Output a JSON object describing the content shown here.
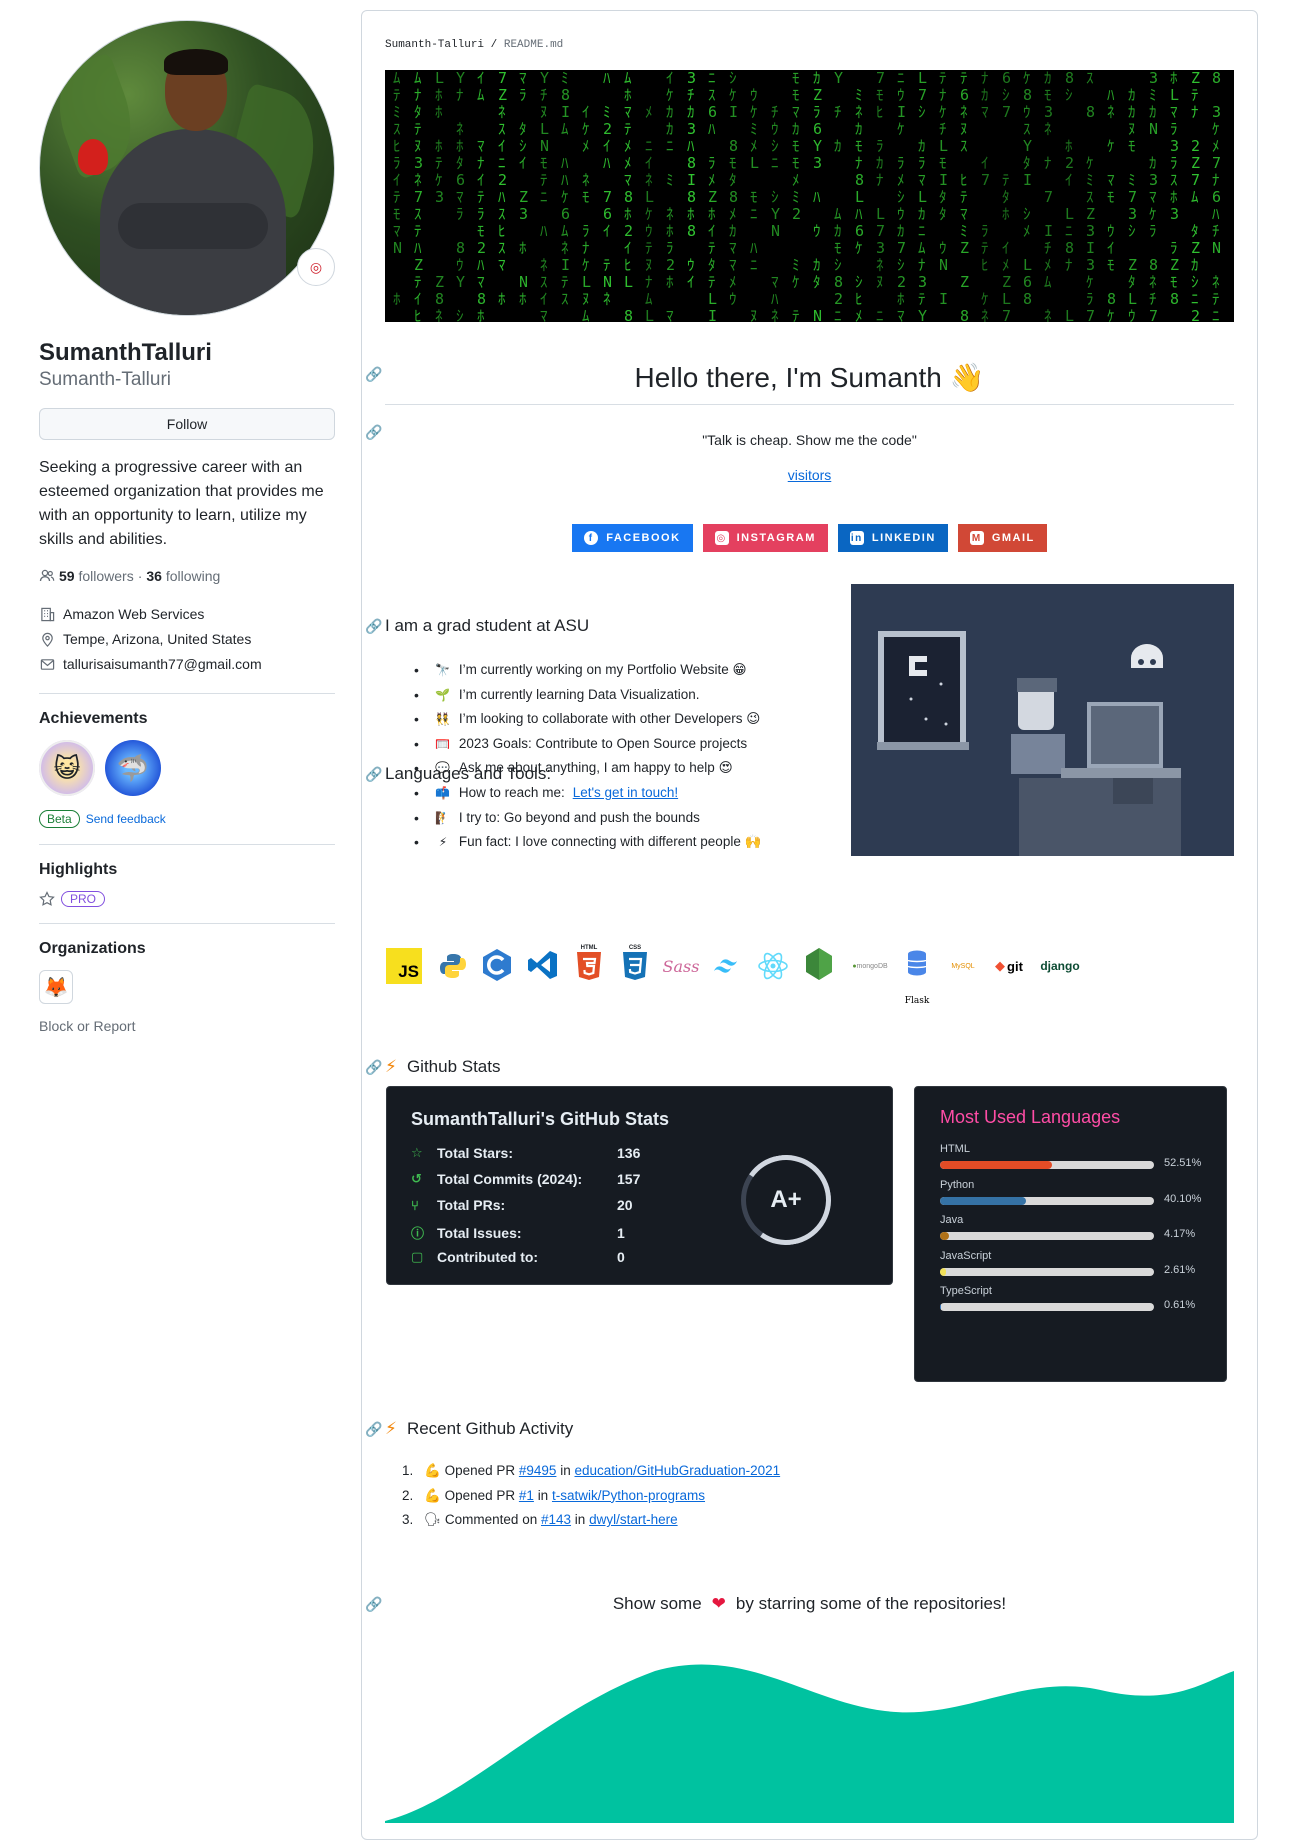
{
  "profile": {
    "name": "SumanthTalluri",
    "login": "Sumanth-Talluri",
    "follow_label": "Follow",
    "bio": "Seeking a progressive career with an esteemed organization that provides me with an opportunity to learn, utilize my skills and abilities.",
    "followers_count": "59",
    "followers_label": "followers",
    "following_count": "36",
    "following_label": "following",
    "company": "Amazon Web Services",
    "location": "Tempe, Arizona, United States",
    "email": "tallurisaisumanth77@gmail.com"
  },
  "achievements": {
    "title": "Achievements",
    "beta": "Beta",
    "feedback": "Send feedback"
  },
  "highlights": {
    "title": "Highlights",
    "pro": "PRO"
  },
  "organizations": {
    "title": "Organizations"
  },
  "block_report": "Block or Report",
  "readme": {
    "crumb_user": "Sumanth-Talluri",
    "crumb_sep": "/",
    "crumb_file": "README.md",
    "hello": "Hello there, I'm Sumanth 👋",
    "quote": "\"Talk is cheap. Show me the code\"",
    "visitors": "visitors",
    "badges": {
      "facebook": "FACEBOOK",
      "instagram": "INSTAGRAM",
      "linkedin": "LINKEDIN",
      "gmail": "GMAIL"
    },
    "grad_heading": "I am a grad student at ASU",
    "bullets": [
      {
        "emoji": "🔭",
        "text": "I’m currently working on my Portfolio Website 😁"
      },
      {
        "emoji": "🌱",
        "text": "I’m currently learning Data Visualization."
      },
      {
        "emoji": "👯",
        "text": "I’m looking to collaborate with other Developers 😉"
      },
      {
        "emoji": "🥅",
        "text": "2023 Goals: Contribute to Open Source projects"
      },
      {
        "emoji": "💬",
        "text": "Ask me about anything, I am happy to help 😍"
      },
      {
        "emoji": "📫",
        "text": "How to reach me:",
        "link": "Let's get in touch!"
      },
      {
        "emoji": "🧗",
        "text": "I try to: Go beyond and push the bounds"
      },
      {
        "emoji": "⚡",
        "text": "Fun fact: I love connecting with different people 🙌"
      }
    ],
    "tools_heading": "Languages and Tools:",
    "tools": {
      "js": "JS",
      "html": "HTML",
      "css": "CSS",
      "sass": "Sass",
      "mongo": "mongoDB",
      "mysql": "MySQL",
      "git": "git",
      "django": "django",
      "flask": "Flask"
    },
    "stats_heading": "Github Stats",
    "activity_heading": "Recent Github Activity",
    "activity": [
      {
        "num": "1.",
        "emoji": "💪",
        "pre": "Opened PR",
        "pr": "#9495",
        "mid": "in",
        "repo": "education/GitHubGraduation-2021"
      },
      {
        "num": "2.",
        "emoji": "💪",
        "pre": "Opened PR",
        "pr": "#1",
        "mid": "in",
        "repo": "t-satwik/Python-programs"
      },
      {
        "num": "3.",
        "emoji": "🗣",
        "pre": "Commented on",
        "pr": "#143",
        "mid": "in",
        "repo": "dwyl/start-here"
      }
    ],
    "show_pre": "Show some",
    "show_post": "by starring some of the repositories!"
  },
  "stats_card": {
    "title": "SumanthTalluri's GitHub Stats",
    "rows": [
      {
        "label": "Total Stars:",
        "value": "136"
      },
      {
        "label": "Total Commits (2024):",
        "value": "157"
      },
      {
        "label": "Total PRs:",
        "value": "20"
      },
      {
        "label": "Total Issues:",
        "value": "1"
      },
      {
        "label": "Contributed to:",
        "value": "0"
      }
    ],
    "grade": "A+"
  },
  "langs_card": {
    "title": "Most Used Languages",
    "items": [
      {
        "name": "HTML",
        "percent": "52.51%",
        "value": 52.51,
        "color": "#e34c26"
      },
      {
        "name": "Python",
        "percent": "40.10%",
        "value": 40.1,
        "color": "#3572a5"
      },
      {
        "name": "Java",
        "percent": "4.17%",
        "value": 4.17,
        "color": "#b07219"
      },
      {
        "name": "JavaScript",
        "percent": "2.61%",
        "value": 2.61,
        "color": "#f1e05a"
      },
      {
        "name": "TypeScript",
        "percent": "0.61%",
        "value": 0.61,
        "color": "#3178c6"
      }
    ]
  }
}
